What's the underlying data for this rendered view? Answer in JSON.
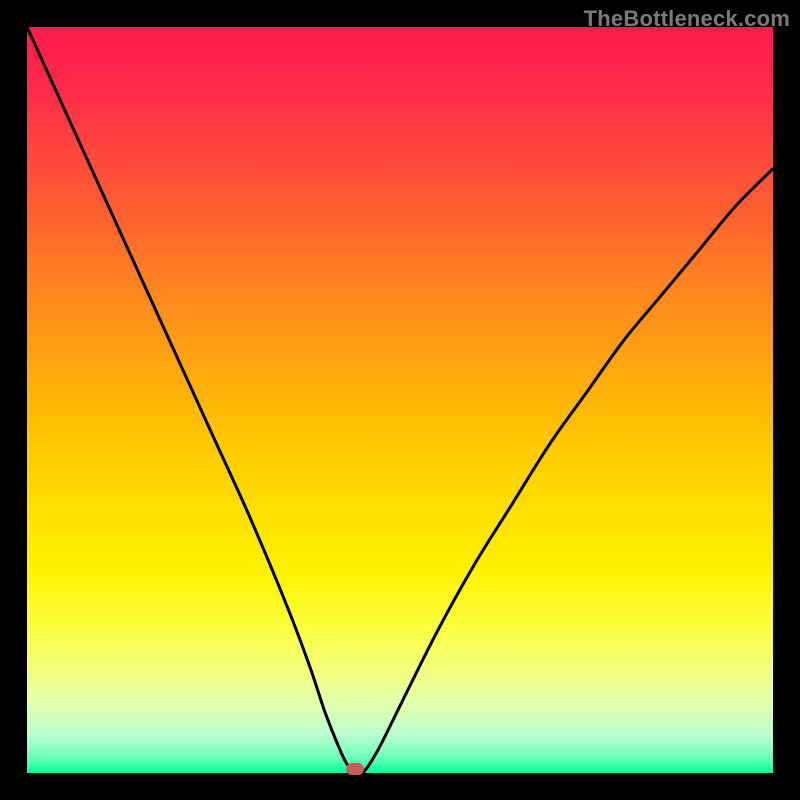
{
  "watermark": "TheBottleneck.com",
  "colors": {
    "frame": "#000000",
    "curve": "#000000",
    "marker": "#cc5a5a",
    "gradient_top": "#ff1a4d",
    "gradient_bottom": "#00ff99"
  },
  "chart_data": {
    "type": "line",
    "title": "",
    "xlabel": "",
    "ylabel": "",
    "xlim": [
      0,
      100
    ],
    "ylim": [
      0,
      100
    ],
    "x": [
      0,
      5,
      10,
      15,
      20,
      25,
      30,
      35,
      38,
      40,
      42,
      43,
      44,
      45,
      47,
      50,
      55,
      60,
      65,
      70,
      75,
      80,
      85,
      90,
      95,
      100
    ],
    "y": [
      100,
      89,
      78,
      67,
      56,
      45,
      34,
      22,
      14,
      8,
      3,
      1,
      0,
      0,
      3,
      9,
      19,
      28,
      36,
      44,
      51,
      58,
      64,
      70,
      76,
      81
    ],
    "marker": {
      "x": 44,
      "y": 0
    },
    "annotations": []
  }
}
